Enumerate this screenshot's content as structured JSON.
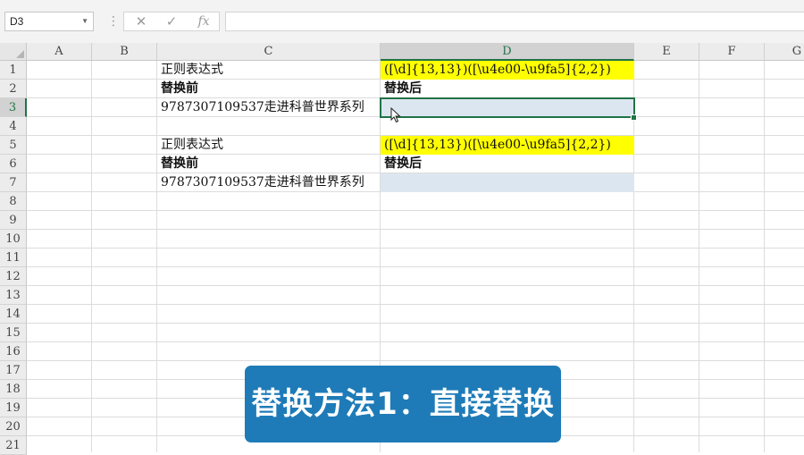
{
  "formula_bar": {
    "name_box": "D3",
    "cancel_icon": "✕",
    "enter_icon": "✓",
    "function_icon": "fx",
    "formula": ""
  },
  "columns": [
    "A",
    "B",
    "C",
    "D",
    "E",
    "F",
    "G"
  ],
  "rows": [
    "1",
    "2",
    "3",
    "4",
    "5",
    "6",
    "7",
    "8",
    "9",
    "10",
    "11",
    "12",
    "13",
    "14",
    "15",
    "16",
    "17",
    "18",
    "19",
    "20",
    "21"
  ],
  "active_cell": "D3",
  "cells": {
    "c1": "正则表达式",
    "d1": "([\\d]{13,13})([\\u4e00-\\u9fa5]{2,2})",
    "c2": "替换前",
    "d2": "替换后",
    "c3": "9787307109537走进科普世界系列",
    "d3": "",
    "c5": "正则表达式",
    "d5": "([\\d]{13,13})([\\u4e00-\\u9fa5]{2,2})",
    "c6": "替换前",
    "d6": "替换后",
    "c7": "9787307109537走进科普世界系列",
    "d7": ""
  },
  "highlight_colors": {
    "regex": "#ffff00",
    "result": "#dce6f1",
    "selection": "#217346"
  },
  "caption": "替换方法1：直接替换"
}
